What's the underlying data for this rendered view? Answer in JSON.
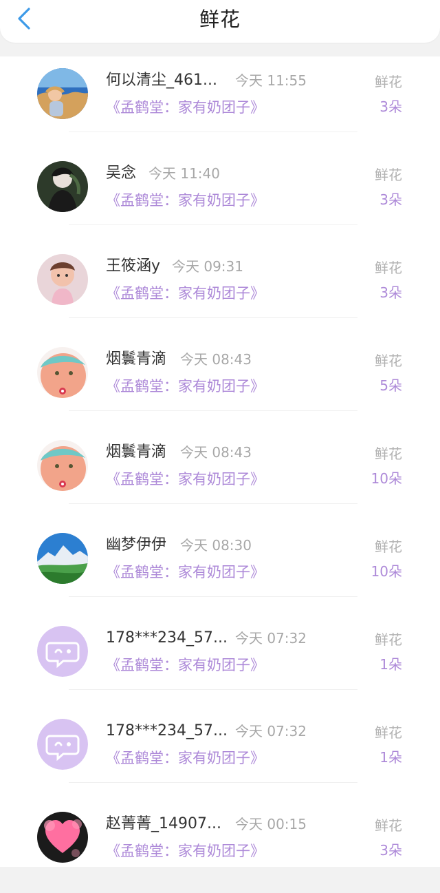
{
  "header": {
    "title": "鲜花",
    "back_icon": "chevron-left-icon",
    "accent_color": "#3d9ae8"
  },
  "records": [
    {
      "name": "何以清尘_461...",
      "time": "今天 11:55",
      "book": "《孟鹤堂：家有奶团子》",
      "gift": "鲜花",
      "count": "3朵",
      "avatar": "landscape-photo"
    },
    {
      "name": "吴念",
      "time": "今天 11:40",
      "book": "《孟鹤堂：家有奶团子》",
      "gift": "鲜花",
      "count": "3朵",
      "avatar": "anime-character"
    },
    {
      "name": "王筱涵y",
      "time": "今天 09:31",
      "book": "《孟鹤堂：家有奶团子》",
      "gift": "鲜花",
      "count": "3朵",
      "avatar": "child-photo"
    },
    {
      "name": "烟鬟青滴",
      "time": "今天 08:43",
      "book": "《孟鹤堂：家有奶团子》",
      "gift": "鲜花",
      "count": "5朵",
      "avatar": "cartoon-face"
    },
    {
      "name": "烟鬟青滴",
      "time": "今天 08:43",
      "book": "《孟鹤堂：家有奶团子》",
      "gift": "鲜花",
      "count": "10朵",
      "avatar": "cartoon-face"
    },
    {
      "name": "幽梦伊伊",
      "time": "今天 08:30",
      "book": "《孟鹤堂：家有奶团子》",
      "gift": "鲜花",
      "count": "10朵",
      "avatar": "mountain-photo"
    },
    {
      "name": "178***234_57...",
      "time": "今天 07:32",
      "book": "《孟鹤堂：家有奶团子》",
      "gift": "鲜花",
      "count": "1朵",
      "avatar": "default-chat-icon"
    },
    {
      "name": "178***234_57...",
      "time": "今天 07:32",
      "book": "《孟鹤堂：家有奶团子》",
      "gift": "鲜花",
      "count": "1朵",
      "avatar": "default-chat-icon"
    },
    {
      "name": "赵菁菁_14907...",
      "time": "今天 00:15",
      "book": "《孟鹤堂：家有奶团子》",
      "gift": "鲜花",
      "count": "3朵",
      "avatar": "heart-photo"
    }
  ],
  "colors": {
    "book_title": "#ad89d8",
    "default_avatar_bg": "#d8c3f2"
  }
}
